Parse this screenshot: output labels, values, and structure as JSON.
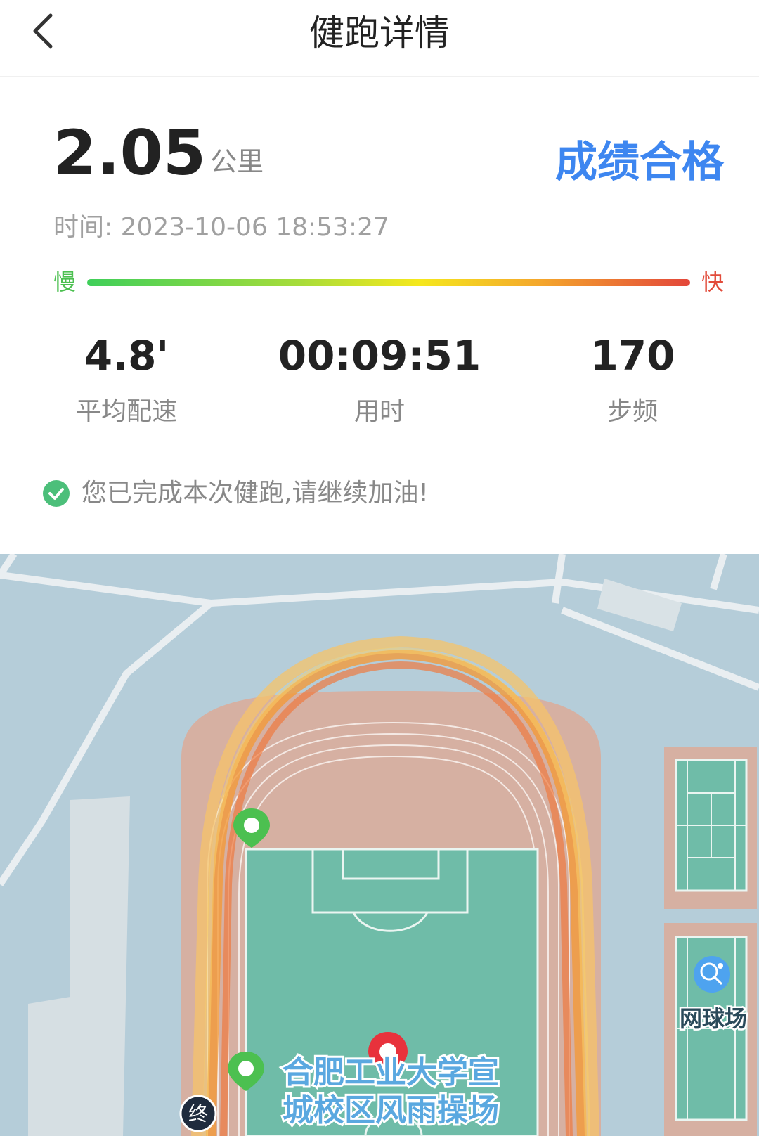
{
  "header": {
    "title": "健跑详情"
  },
  "summary": {
    "distance": "2.05",
    "distance_unit": "公里",
    "grade": "成绩合格",
    "time_label": "时间: 2023-10-06 18:53:27",
    "speed_scale": {
      "slow": "慢",
      "fast": "快"
    }
  },
  "stats": [
    {
      "value": "4.8'",
      "label": "平均配速"
    },
    {
      "value": "00:09:51",
      "label": "用时"
    },
    {
      "value": "170",
      "label": "步频"
    }
  ],
  "notice": "您已完成本次健跑,请继续加油!",
  "map": {
    "poi_tennis": "网球场",
    "poi_field_line1": "合肥工业大学宣",
    "poi_field_line2": "城校区风雨操场",
    "end_marker": "终"
  },
  "colors": {
    "accent": "#3d86f0",
    "slow": "#4cc050",
    "fast": "#e24b3a",
    "success": "#4cbf7a",
    "water": "#b5cdd9",
    "track": "#d6b0a2",
    "field": "#6fbca8",
    "route": "#f29a3a"
  },
  "icons": {
    "back": "chevron-left-icon",
    "check": "check-circle-icon",
    "tennis": "tennis-icon"
  }
}
